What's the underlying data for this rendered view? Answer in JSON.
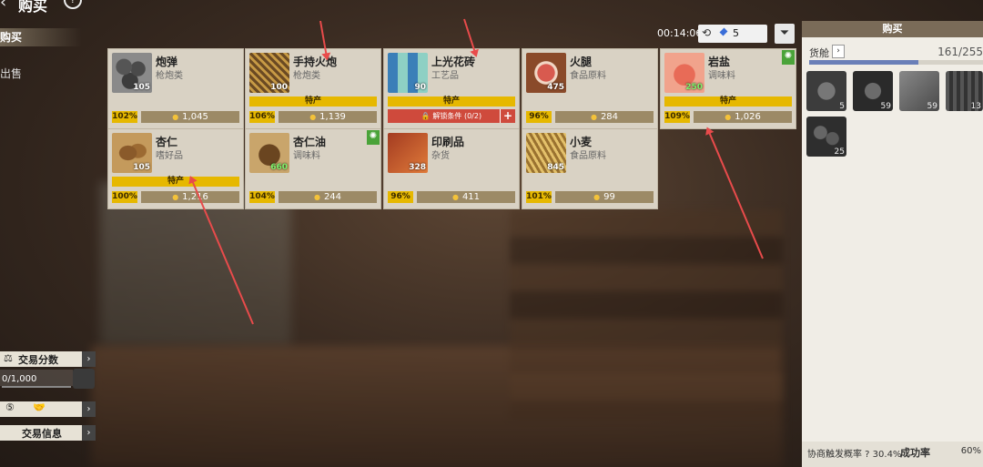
{
  "header": {
    "title": "购买",
    "back": "‹",
    "help": "?"
  },
  "tabs": {
    "buy": "购买",
    "sell": "出售"
  },
  "toolbar": {
    "timer": "00:14:06",
    "refresh_cost": "5",
    "filter_icon": "filter-icon"
  },
  "goods": [
    {
      "name": "炮弹",
      "category": "枪炮类",
      "qty": "105",
      "percent": "102%",
      "price": "1,045",
      "special": "",
      "locked": "",
      "badge": ""
    },
    {
      "name": "手持火炮",
      "category": "枪炮类",
      "qty": "100",
      "percent": "106%",
      "price": "1,139",
      "special": "特产",
      "locked": "",
      "badge": ""
    },
    {
      "name": "上光花砖",
      "category": "工艺品",
      "qty": "90",
      "percent": "",
      "price": "",
      "special": "特产",
      "locked": "解锁条件 (0/2)",
      "badge": ""
    },
    {
      "name": "火腿",
      "category": "食品原料",
      "qty": "475",
      "percent": "96%",
      "price": "284",
      "special": "",
      "locked": "",
      "badge": ""
    },
    {
      "name": "岩盐",
      "category": "调味料",
      "qty": "250",
      "percent": "109%",
      "price": "1,026",
      "special": "特产",
      "locked": "",
      "badge": "✺"
    },
    {
      "name": "杏仁",
      "category": "嗜好品",
      "qty": "105",
      "percent": "100%",
      "price": "1,216",
      "special": "特产",
      "locked": "",
      "badge": ""
    },
    {
      "name": "杏仁油",
      "category": "调味料",
      "qty": "660",
      "percent": "104%",
      "price": "244",
      "special": "",
      "locked": "",
      "badge": "✺"
    },
    {
      "name": "印刷品",
      "category": "杂货",
      "qty": "328",
      "percent": "96%",
      "price": "411",
      "special": "",
      "locked": "",
      "badge": ""
    },
    {
      "name": "小麦",
      "category": "食品原料",
      "qty": "845",
      "percent": "101%",
      "price": "99",
      "special": "",
      "locked": "",
      "badge": ""
    }
  ],
  "right_panel": {
    "title": "购买",
    "cargo_label": "货舱",
    "cargo_value": "161/255",
    "cargo_fill": 0.63,
    "slots": [
      "5",
      "59",
      "59",
      "13",
      "25"
    ],
    "bottom_left": "协商触发概率 ? 30.4%",
    "bottom_right_label": "成功率",
    "bottom_right_value": "60%"
  },
  "left_widgets": {
    "trade_score": "交易分数",
    "score_value": "0/1,000",
    "trade_info": "交易信息"
  }
}
